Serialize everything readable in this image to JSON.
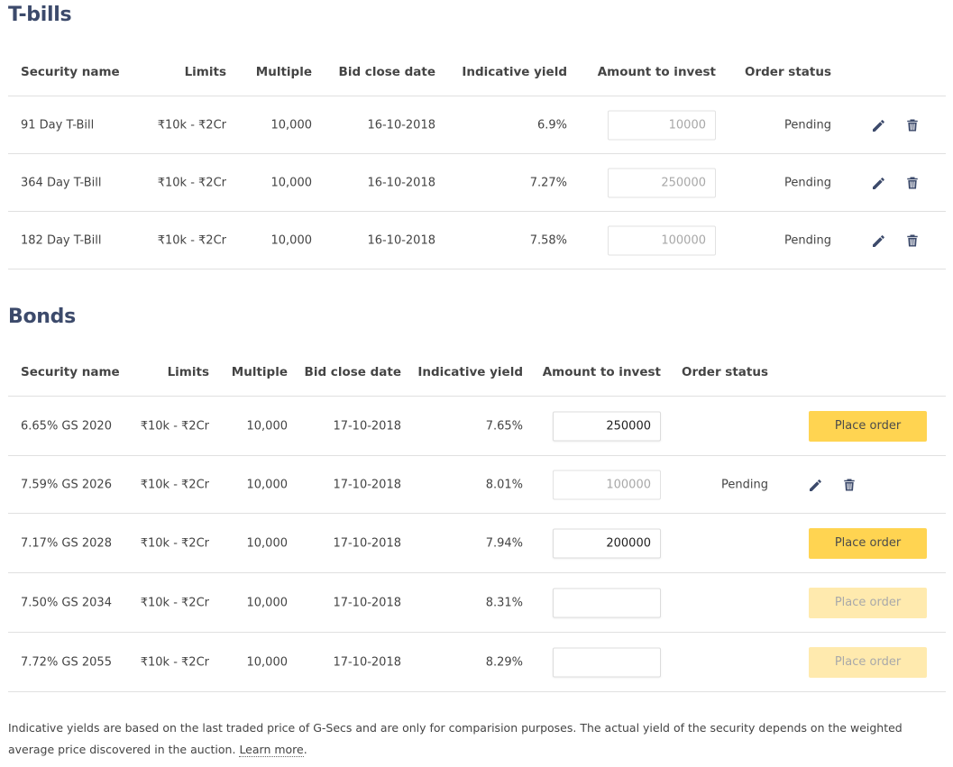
{
  "tbills": {
    "title": "T-bills",
    "headers": {
      "security_name": "Security name",
      "limits": "Limits",
      "multiple": "Multiple",
      "bid_close_date": "Bid close date",
      "indicative_yield": "Indicative yield",
      "amount_to_invest": "Amount to invest",
      "order_status": "Order status"
    },
    "rows": [
      {
        "name": "91 Day T-Bill",
        "limits": "₹10k - ₹2Cr",
        "multiple": "10,000",
        "date": "16-10-2018",
        "yield": "6.9%",
        "amount": "10000",
        "status": "Pending"
      },
      {
        "name": "364 Day T-Bill",
        "limits": "₹10k - ₹2Cr",
        "multiple": "10,000",
        "date": "16-10-2018",
        "yield": "7.27%",
        "amount": "250000",
        "status": "Pending"
      },
      {
        "name": "182 Day T-Bill",
        "limits": "₹10k - ₹2Cr",
        "multiple": "10,000",
        "date": "16-10-2018",
        "yield": "7.58%",
        "amount": "100000",
        "status": "Pending"
      }
    ]
  },
  "bonds": {
    "title": "Bonds",
    "headers": {
      "security_name": "Security name",
      "limits": "Limits",
      "multiple": "Multiple",
      "bid_close_date": "Bid close date",
      "indicative_yield": "Indicative yield",
      "amount_to_invest": "Amount to invest",
      "order_status": "Order status"
    },
    "rows": [
      {
        "name": "6.65% GS 2020",
        "limits": "₹10k - ₹2Cr",
        "multiple": "10,000",
        "date": "17-10-2018",
        "yield": "7.65%",
        "amount": "250000",
        "action": "Place order"
      },
      {
        "name": "7.59% GS 2026",
        "limits": "₹10k - ₹2Cr",
        "multiple": "10,000",
        "date": "17-10-2018",
        "yield": "8.01%",
        "amount": "100000",
        "status": "Pending"
      },
      {
        "name": "7.17% GS 2028",
        "limits": "₹10k - ₹2Cr",
        "multiple": "10,000",
        "date": "17-10-2018",
        "yield": "7.94%",
        "amount": "200000",
        "action": "Place order"
      },
      {
        "name": "7.50% GS 2034",
        "limits": "₹10k - ₹2Cr",
        "multiple": "10,000",
        "date": "17-10-2018",
        "yield": "8.31%",
        "amount": "",
        "action": "Place order"
      },
      {
        "name": "7.72% GS 2055",
        "limits": "₹10k - ₹2Cr",
        "multiple": "10,000",
        "date": "17-10-2018",
        "yield": "8.29%",
        "amount": "",
        "action": "Place order"
      }
    ]
  },
  "footer": {
    "note": "Indicative yields are based on the last traded price of G-Secs and are only for comparision purposes. The actual yield of the security depends on the weighted average price discovered in the auction.",
    "link": "Learn more",
    "period": "."
  },
  "colors": {
    "heading": "#3c4a6b",
    "button": "#ffd451",
    "button_disabled": "#ffeaae",
    "border": "#e0e0e0",
    "icon": "#3c4a6b"
  },
  "icons": {
    "edit": "pencil-icon",
    "delete": "trash-icon"
  }
}
